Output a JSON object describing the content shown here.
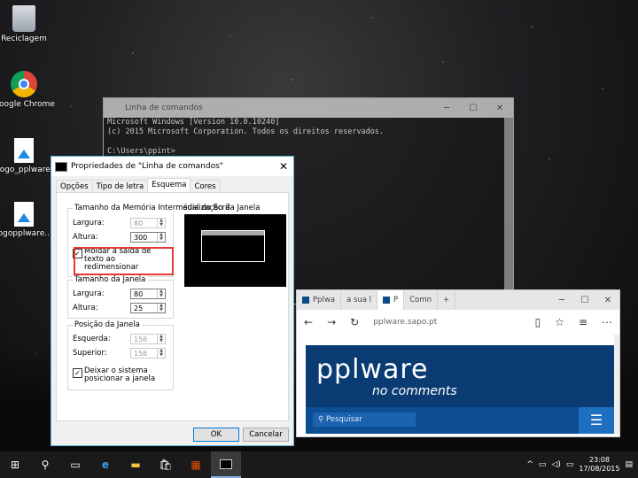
{
  "desktop": {
    "icons": [
      {
        "label": "Reciclagem",
        "icon": "recycle-bin-icon"
      },
      {
        "label": "Google Chrome",
        "icon": "chrome-icon"
      },
      {
        "label": "logo_pplware",
        "icon": "image-file-icon"
      },
      {
        "label": "logopplware...",
        "icon": "image-file-icon"
      }
    ]
  },
  "cmd_window": {
    "title": "Linha de comandos",
    "lines": [
      "Microsoft Windows [Version 10.0.10240]",
      "(c) 2015 Microsoft Corporation. Todos os direitos reservados.",
      "",
      "C:\\Users\\ppint>"
    ]
  },
  "properties_dialog": {
    "title": "Propriedades de \"Linha de comandos\"",
    "tabs": [
      "Opções",
      "Tipo de letra",
      "Esquema",
      "Cores"
    ],
    "active_tab": "Esquema",
    "buffer_group": {
      "label": "Tamanho da Memória Intermédia do Ecrã",
      "width_label": "Largura:",
      "width_value": "80",
      "height_label": "Altura:",
      "height_value": "300",
      "wrap_label": "Moldar a saída de texto ao redimensionar",
      "wrap_checked": true
    },
    "preview_label": "sualização da Janela",
    "window_size_group": {
      "label": "Tamanho da Janela",
      "width_label": "Largura:",
      "width_value": "80",
      "height_label": "Altura:",
      "height_value": "25"
    },
    "window_position_group": {
      "label": "Posição da Janela",
      "left_label": "Esquerda:",
      "left_value": "156",
      "top_label": "Superior:",
      "top_value": "156",
      "auto_label": "Deixar o sistema posicionar a janela",
      "auto_checked": true
    },
    "ok_label": "OK",
    "cancel_label": "Cancelar"
  },
  "browser": {
    "tabs": [
      {
        "label": "Pplwa",
        "active": false
      },
      {
        "label": "a sua l",
        "active": false
      },
      {
        "label": "P",
        "active": true
      },
      {
        "label": "Comn",
        "active": false
      }
    ],
    "new_tab": "+",
    "url": "pplware.sapo.pt",
    "site_logo_top": "pplware",
    "site_logo_tagline": "no comments",
    "search_placeholder": "Pesquisar"
  },
  "taskbar": {
    "time": "23:08",
    "date": "17/08/2015"
  }
}
